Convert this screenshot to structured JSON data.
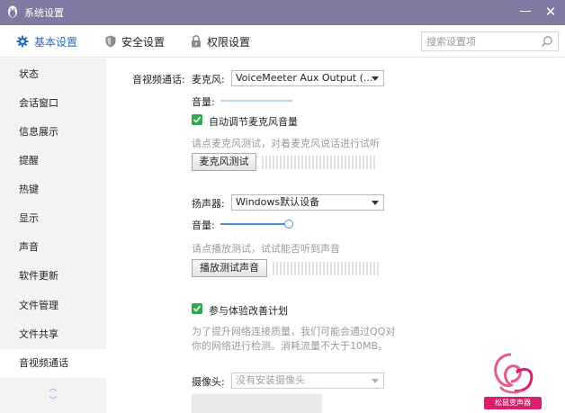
{
  "window": {
    "title": "系统设置",
    "minimize_glyph": "—",
    "close_glyph": "✕"
  },
  "nav": {
    "tabs": [
      {
        "label": "基本设置",
        "icon": "gear-icon",
        "active": true
      },
      {
        "label": "安全设置",
        "icon": "shield-icon",
        "active": false
      },
      {
        "label": "权限设置",
        "icon": "lock-icon",
        "active": false
      }
    ],
    "search_placeholder": "搜索设置项"
  },
  "sidebar": {
    "items": [
      {
        "label": "状态"
      },
      {
        "label": "会话窗口"
      },
      {
        "label": "信息展示"
      },
      {
        "label": "提醒"
      },
      {
        "label": "热键"
      },
      {
        "label": "显示"
      },
      {
        "label": "声音"
      },
      {
        "label": "软件更新"
      },
      {
        "label": "文件管理"
      },
      {
        "label": "文件共享"
      },
      {
        "label": "音视频通话",
        "active": true
      }
    ],
    "scroll_up": "︿",
    "scroll_down": "﹀"
  },
  "content": {
    "section_label": "音视频通话:",
    "mic": {
      "label": "麦克风:",
      "device": "VoiceMeeter Aux Output (...",
      "volume_label": "音量:",
      "volume_level": 0,
      "auto_adjust_label": "自动调节麦克风音量",
      "auto_adjust_checked": true,
      "hint": "请点麦克风测试，对着麦克风说话进行试听",
      "test_button": "麦克风测试"
    },
    "speaker": {
      "label": "扬声器:",
      "device": "Windows默认设备",
      "volume_label": "音量:",
      "volume_level": 1.0,
      "hint": "请点播放测试，试试能否听到声音",
      "test_button": "播放测试声音"
    },
    "experience": {
      "label": "参与体验改善计划",
      "checked": true,
      "desc_line1": "为了提升网络连接质量，我们可能会通过QQ对",
      "desc_line2": "你的网络进行检测。消耗流量不大于10MB。"
    },
    "camera": {
      "label": "摄像头:",
      "device": "没有安装摄像头"
    }
  },
  "watermark": {
    "tag_text": "松鼠变声器"
  },
  "colors": {
    "titlebar": "#7f7aa2",
    "accent": "#2a6bc4",
    "check": "#2ea84a",
    "sidebar_bg": "#f3f3f3",
    "logo": "#d81e6c"
  }
}
